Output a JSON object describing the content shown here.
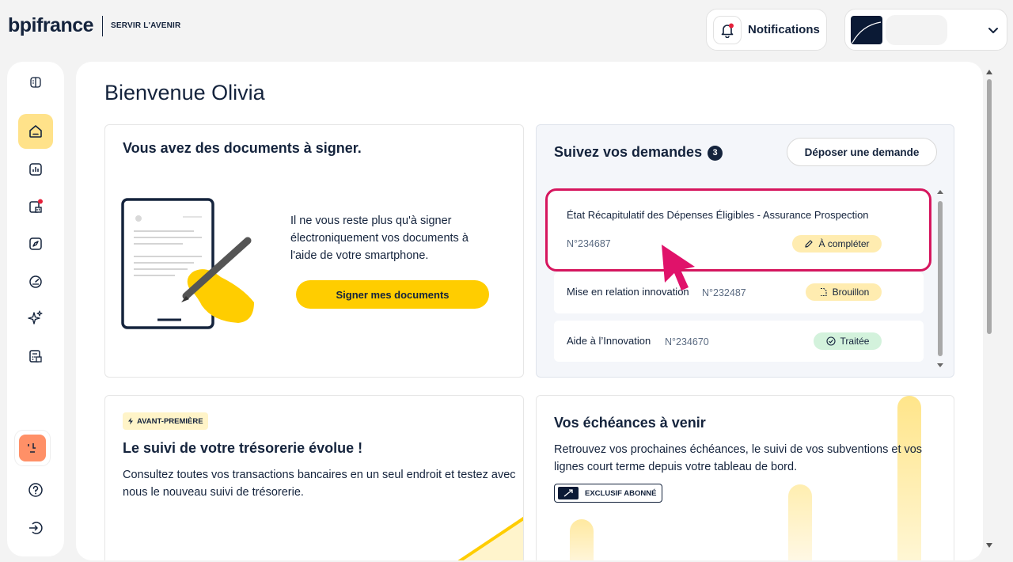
{
  "header": {
    "logo_word": "bpifrance",
    "logo_tagline": "SERVIR L'AVENIR",
    "notifications_label": "Notifications"
  },
  "sidebar": {
    "items": [
      {
        "icon": "panel-toggle-icon"
      },
      {
        "icon": "home-icon",
        "active": true
      },
      {
        "icon": "chart-icon"
      },
      {
        "icon": "financing-icon",
        "has_dot": true
      },
      {
        "icon": "compass-icon"
      },
      {
        "icon": "gauge-icon"
      },
      {
        "icon": "sparkles-icon"
      },
      {
        "icon": "calculator-icon"
      }
    ],
    "bottom": [
      {
        "icon": "help-icon"
      },
      {
        "icon": "logout-icon"
      }
    ]
  },
  "main": {
    "title": "Bienvenue Olivia",
    "sign_card": {
      "title": "Vous avez des documents à signer.",
      "text": "Il ne vous reste plus qu'à signer électroniquement vos documents à l'aide de votre smartphone.",
      "button": "Signer mes documents"
    },
    "requests_card": {
      "title": "Suivez vos demandes",
      "count": "3",
      "button": "Déposer une demande",
      "items": [
        {
          "name": "État Récapitulatif des Dépenses Éligibles - Assurance Prospection",
          "number": "N°234687",
          "status": "À compléter",
          "status_icon": "pencil-icon"
        },
        {
          "name": "Mise en relation innovation",
          "number": "N°232487",
          "status": "Brouillon",
          "status_icon": "draft-icon"
        },
        {
          "name": "Aide à l’Innovation",
          "number": "N°234670",
          "status": "Traitée",
          "status_icon": "check-circle-icon"
        }
      ]
    },
    "treasury_card": {
      "tag": "AVANT-PREMIÈRE",
      "title": "Le suivi de votre trésorerie évolue !",
      "text": "Consultez toutes vos transactions bancaires en un seul endroit et testez avec nous le nouveau suivi de trésorerie."
    },
    "deadlines_card": {
      "title": "Vos échéances à venir",
      "text": "Retrouvez vos prochaines échéances, le suivi de vos subventions et vos lignes court terme depuis votre tableau de bord.",
      "tag": "EXCLUSIF ABONNÉ"
    }
  },
  "colors": {
    "navy": "#14233c",
    "yellow": "#ffcd00",
    "highlight": "#d6165e"
  }
}
